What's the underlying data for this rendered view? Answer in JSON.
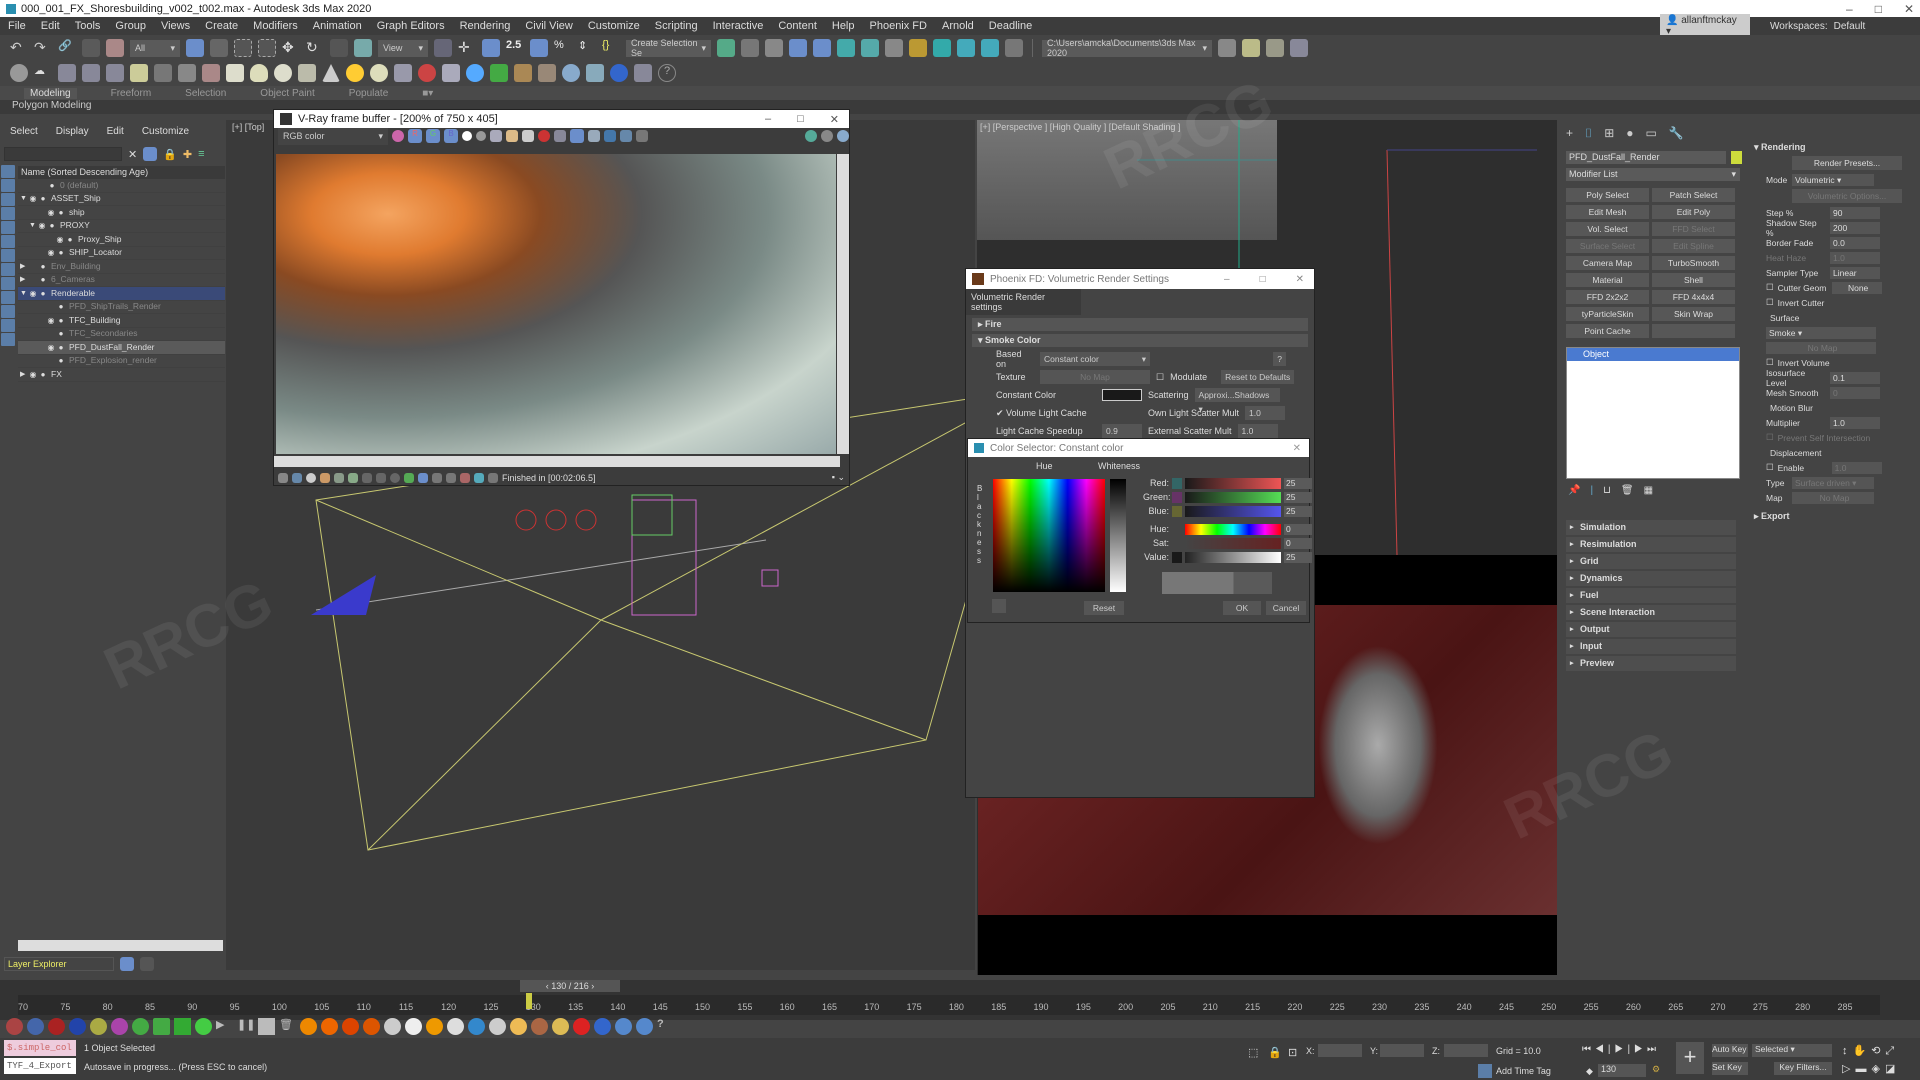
{
  "window": {
    "title": "000_001_FX_Shoresbuilding_v002_t002.max - Autodesk 3ds Max 2020",
    "min": "–",
    "max": "□",
    "close": "✕"
  },
  "menu": [
    "File",
    "Edit",
    "Tools",
    "Group",
    "Views",
    "Create",
    "Modifiers",
    "Animation",
    "Graph Editors",
    "Rendering",
    "Civil View",
    "Customize",
    "Scripting",
    "Interactive",
    "Content",
    "Help",
    "Phoenix FD",
    "Arnold",
    "Deadline"
  ],
  "user": "allanftmckay",
  "workspaces_label": "Workspaces:",
  "workspace": "Default",
  "toolbar": {
    "filter": "All",
    "ref_coord": "View",
    "selection_set": "Create Selection Se",
    "project_path": "C:\\Users\\amcka\\Documents\\3ds Max 2020"
  },
  "ribbon": {
    "tabs": [
      "Modeling",
      "Freeform",
      "Selection",
      "Object Paint",
      "Populate"
    ],
    "active": "Modeling",
    "sub": "Polygon Modeling"
  },
  "scene_explorer": {
    "menu": [
      "Select",
      "Display",
      "Edit",
      "Customize"
    ],
    "header": "Name (Sorted Descending Age)",
    "rows": [
      {
        "label": "0 (default)",
        "indent": 1,
        "dim": true
      },
      {
        "label": "ASSET_Ship",
        "indent": 0,
        "arrow": "▼",
        "eye": true
      },
      {
        "label": "ship",
        "indent": 2,
        "eye": true
      },
      {
        "label": "PROXY",
        "indent": 1,
        "arrow": "▼",
        "eye": true
      },
      {
        "label": "Proxy_Ship",
        "indent": 3,
        "eye": true
      },
      {
        "label": "SHIP_Locator",
        "indent": 2,
        "eye": true
      },
      {
        "label": "Env_Building",
        "indent": 0,
        "arrow": "▶",
        "dim": true
      },
      {
        "label": "6_Cameras",
        "indent": 0,
        "arrow": "▶",
        "dim": true
      },
      {
        "label": "Renderable",
        "indent": 0,
        "arrow": "▼",
        "eye": true,
        "selected": true
      },
      {
        "label": "PFD_ShipTrails_Render",
        "indent": 2,
        "dim": true
      },
      {
        "label": "TFC_Building",
        "indent": 2,
        "eye": true
      },
      {
        "label": "TFC_Secondaries",
        "indent": 2,
        "dim": true
      },
      {
        "label": "PFD_DustFall_Render",
        "indent": 2,
        "eye": true,
        "highlight": true
      },
      {
        "label": "PFD_Explosion_render",
        "indent": 2,
        "dim": true
      },
      {
        "label": "FX",
        "indent": 0,
        "arrow": "▶",
        "eye": true
      }
    ],
    "layer_explorer": "Layer Explorer"
  },
  "viewport_left": {
    "label": "[+] [Top]"
  },
  "viewport_right": {
    "label": "[+] [Perspective ] [High Quality ] [Default Shading ]"
  },
  "vray": {
    "title": "V-Ray frame buffer - [200% of 750 x 405]",
    "channel": "RGB color",
    "r": "R",
    "g": "G",
    "b": "B",
    "status": "Finished in [00:02:06.5]"
  },
  "phoenix": {
    "title": "Phoenix FD: Volumetric Render Settings",
    "tab": "Volumetric Render settings",
    "fire": "Fire",
    "smoke": "Smoke Color",
    "based_on_label": "Based on",
    "based_on": "Constant color",
    "help": "?",
    "texture_label": "Texture",
    "texture": "No Map",
    "modulate": "Modulate",
    "reset": "Reset to Defaults",
    "const_label": "Constant Color",
    "scattering_label": "Scattering",
    "scattering": "Approxi...Shadows",
    "vlc": "Volume Light Cache",
    "own_scatter_label": "Own Light Scatter Mult",
    "own_scatter": "1.0",
    "speedup_label": "Light Cache Speedup",
    "speedup": "0.9",
    "ext_scatter_label": "External Scatter Mult",
    "ext_scatter": "1.0"
  },
  "color_selector": {
    "title": "Color Selector: Constant color",
    "hue": "Hue",
    "whiteness": "Whiteness",
    "blackness": "Blackness",
    "sliders": [
      {
        "label": "Red:",
        "value": "25"
      },
      {
        "label": "Green:",
        "value": "25"
      },
      {
        "label": "Blue:",
        "value": "25"
      },
      {
        "label": "Hue:",
        "value": "0"
      },
      {
        "label": "Sat:",
        "value": "0"
      },
      {
        "label": "Value:",
        "value": "25"
      }
    ],
    "reset": "Reset",
    "ok": "OK",
    "cancel": "Cancel"
  },
  "command_panel": {
    "object_name": "PFD_DustFall_Render",
    "object_color": "#cddc3c",
    "modifier_list": "Modifier List",
    "modifiers": [
      {
        "label": "Poly Select"
      },
      {
        "label": "Patch Select"
      },
      {
        "label": "Edit Mesh"
      },
      {
        "label": "Edit Poly"
      },
      {
        "label": "Vol. Select"
      },
      {
        "label": "FFD Select",
        "disabled": true
      },
      {
        "label": "Surface Select",
        "disabled": true
      },
      {
        "label": "Edit Spline",
        "disabled": true
      },
      {
        "label": "Camera Map"
      },
      {
        "label": "TurboSmooth"
      },
      {
        "label": "Material"
      },
      {
        "label": "Shell"
      },
      {
        "label": "FFD 2x2x2"
      },
      {
        "label": "FFD 4x4x4"
      },
      {
        "label": "tyParticleSkin"
      },
      {
        "label": "Skin Wrap"
      },
      {
        "label": "Point Cache"
      },
      {
        "label": ""
      }
    ],
    "stack_item": "Object",
    "rollouts": [
      "Simulation",
      "Resimulation",
      "Grid",
      "Dynamics",
      "Fuel",
      "Scene Interaction",
      "Output",
      "Input",
      "Preview"
    ]
  },
  "rendering": {
    "title": "Rendering",
    "presets": "Render Presets...",
    "mode_label": "Mode",
    "mode": "Volumetric",
    "vol_options": "Volumetric Options...",
    "fields": [
      {
        "label": "Step %",
        "value": "90"
      },
      {
        "label": "Shadow Step %",
        "value": "200"
      },
      {
        "label": "Border Fade",
        "value": "0.0"
      },
      {
        "label": "Heat Haze",
        "value": "1.0",
        "dim": true
      },
      {
        "label": "Sampler Type",
        "value": "Linear"
      }
    ],
    "cutter_geom": "Cutter Geom",
    "cutter_none": "None",
    "invert_cutter": "Invert Cutter",
    "surface_label": "Surface",
    "surface": "Smoke",
    "surface_map": "No Map",
    "invert_volume": "Invert Volume",
    "iso_label": "Isosurface Level",
    "iso": "0.1",
    "mesh_smooth_label": "Mesh Smooth",
    "mesh_smooth": "0",
    "motion_blur": "Motion Blur",
    "multiplier_label": "Multiplier",
    "multiplier": "1.0",
    "prevent": "Prevent Self Intersection",
    "displacement": "Displacement",
    "enable": "Enable",
    "enable_val": "1.0",
    "type_label": "Type",
    "type": "Surface driven",
    "map_label": "Map",
    "map": "No Map",
    "export": "Export"
  },
  "timeline": {
    "frame": "130 / 216",
    "ticks": [
      "70",
      "75",
      "80",
      "85",
      "90",
      "95",
      "100",
      "105",
      "110",
      "115",
      "120",
      "125",
      "130",
      "135",
      "140",
      "145",
      "150",
      "155",
      "160",
      "165",
      "170",
      "175",
      "180",
      "185",
      "190",
      "195",
      "200",
      "205",
      "210",
      "215",
      "220",
      "225",
      "230",
      "235",
      "240",
      "245",
      "250",
      "255",
      "260",
      "265",
      "270",
      "275",
      "280",
      "285"
    ],
    "current_frame": 130,
    "total_frames": 216
  },
  "status": {
    "maxscript1": "$.simple_col",
    "maxscript2": "TYF_4_Export",
    "selected": "1 Object Selected",
    "prompt": "Autosave in progress... (Press ESC to cancel)",
    "x_label": "X:",
    "y_label": "Y:",
    "z_label": "Z:",
    "grid": "Grid = 10.0",
    "add_time_tag": "Add Time Tag",
    "frame_field": "130",
    "auto_key": "Auto Key",
    "set_key": "Set Key",
    "key_mode": "Selected",
    "key_filters": "Key Filters..."
  },
  "watermark": "RRCG"
}
